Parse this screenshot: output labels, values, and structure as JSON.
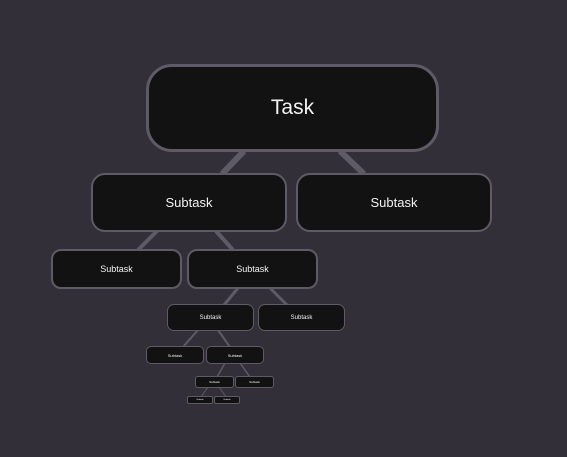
{
  "colors": {
    "background": "#322f38",
    "node_fill": "#121212",
    "node_border": "#5e5b66",
    "edge": "#5e5b66",
    "text": "#f2f2f2"
  },
  "tree": {
    "root": "Task",
    "level1": [
      "Subtask",
      "Subtask"
    ],
    "level2": [
      "Subtask",
      "Subtask"
    ],
    "level3": [
      "Subtask",
      "Subtask"
    ],
    "level4": [
      "Subtask",
      "Subtask"
    ],
    "level5": [
      "Subtask",
      "Subtask"
    ],
    "level6": [
      "Subtask",
      "Subtask"
    ]
  }
}
